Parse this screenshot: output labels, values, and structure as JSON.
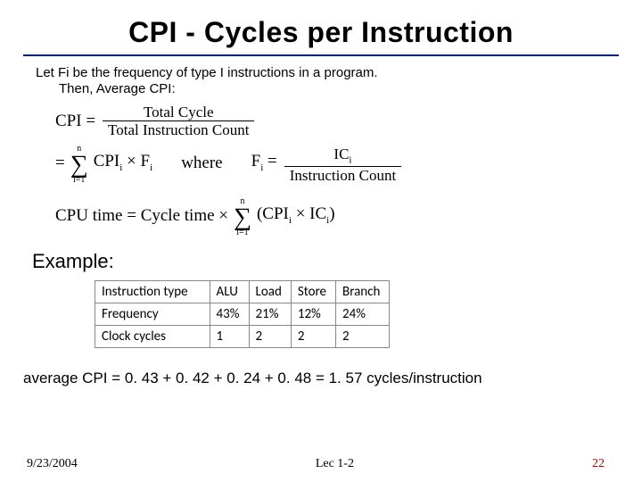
{
  "title": "CPI - Cycles per Instruction",
  "intro_line1": "Let Fi be the frequency of type I instructions in a program.",
  "intro_line2": "Then, Average CPI:",
  "formulas": {
    "cpi_eq": "CPI =",
    "frac1_num": "Total Cycle",
    "frac1_den": "Total Instruction Count",
    "eq2": "=",
    "sum_top": "n",
    "sum_bot": "i=1",
    "term2": "CPI",
    "sub_i": "i",
    "times": " × F",
    "where": "where",
    "feq": "F",
    "feq2": " =",
    "frac2_num": "IC",
    "frac2_den": "Instruction Count",
    "cputime": "CPU time = Cycle time ×",
    "paren_l": "(CPI",
    "paren_mid": " × IC",
    "paren_r": ")"
  },
  "example_label": "Example:",
  "table": {
    "headers": [
      "Instruction type",
      "ALU",
      "Load",
      "Store",
      "Branch"
    ],
    "rows": [
      {
        "label": "Frequency",
        "cells": [
          "43%",
          "21%",
          "12%",
          "24%"
        ]
      },
      {
        "label": "Clock cycles",
        "cells": [
          "1",
          "2",
          "2",
          "2"
        ]
      }
    ]
  },
  "answer": "average CPI = 0. 43 + 0. 42 + 0. 24 + 0. 48 =  1. 57 cycles/instruction",
  "footer": {
    "date": "9/23/2004",
    "center": "Lec 1-2",
    "page": "22"
  },
  "chart_data": {
    "type": "table",
    "title": "CPI example",
    "columns": [
      "Instruction type",
      "ALU",
      "Load",
      "Store",
      "Branch"
    ],
    "rows": [
      [
        "Frequency",
        "43%",
        "21%",
        "12%",
        "24%"
      ],
      [
        "Clock cycles",
        1,
        2,
        2,
        2
      ]
    ],
    "derived": {
      "average_CPI": 1.57,
      "terms": [
        0.43,
        0.42,
        0.24,
        0.48
      ]
    }
  }
}
